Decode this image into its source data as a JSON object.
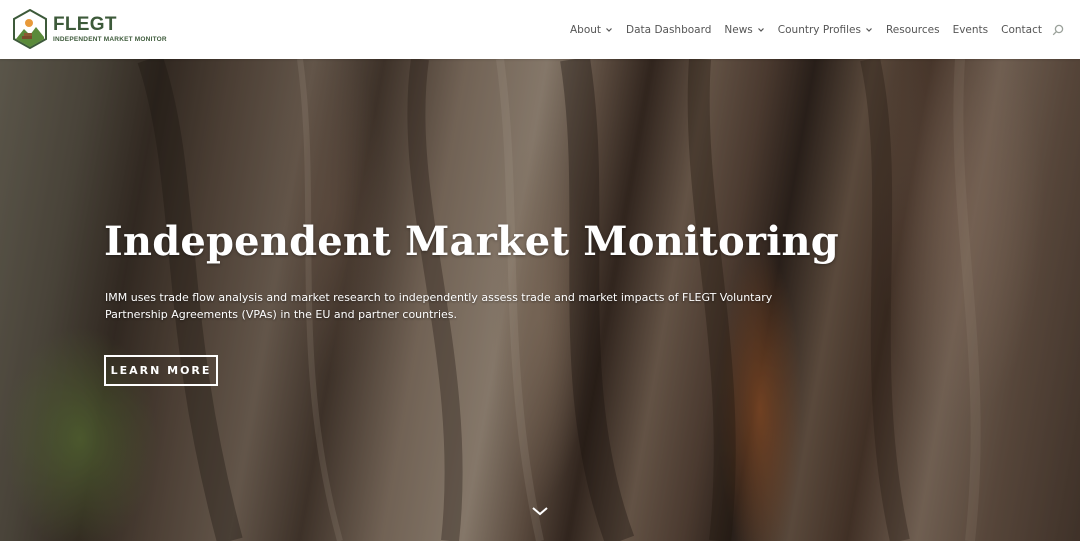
{
  "brand": {
    "title": "FLEGT",
    "subtitle": "INDEPENDENT MARKET MONITOR",
    "colors": {
      "primary": "#3d5a3a",
      "accent_orange": "#e89a3a",
      "accent_green": "#5a8a3a"
    },
    "icon": "hexagon-landscape-logo"
  },
  "nav": {
    "items": [
      {
        "label": "About",
        "has_dropdown": true
      },
      {
        "label": "Data Dashboard",
        "has_dropdown": false
      },
      {
        "label": "News",
        "has_dropdown": true
      },
      {
        "label": "Country Profiles",
        "has_dropdown": true
      },
      {
        "label": "Resources",
        "has_dropdown": false
      },
      {
        "label": "Events",
        "has_dropdown": false
      },
      {
        "label": "Contact",
        "has_dropdown": false
      }
    ],
    "search_icon": "search-icon"
  },
  "hero": {
    "title": "Independent Market Monitoring",
    "description": "IMM uses trade flow analysis and market research to independently assess trade and market impacts of FLEGT Voluntary Partnership Agreements (VPAs) in the EU and partner countries.",
    "cta_label": "LEARN MORE",
    "scroll_icon": "chevron-down-icon"
  }
}
